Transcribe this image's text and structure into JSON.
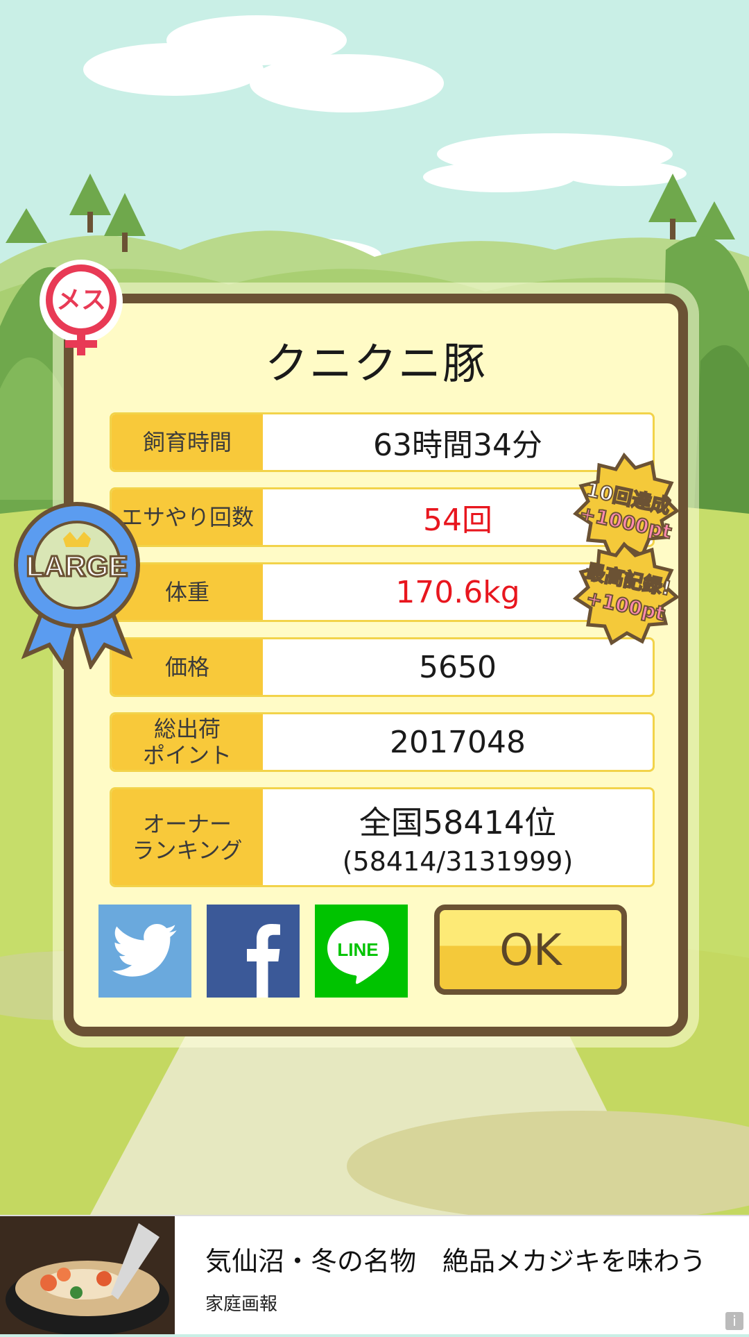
{
  "dialog": {
    "title": "クニクニ豚",
    "gender_badge": "メス",
    "size_ribbon": "LARGE",
    "stats": [
      {
        "label": "飼育時間",
        "value": "63時間34分"
      },
      {
        "label": "エサやり回数",
        "value": "54回"
      },
      {
        "label": "体重",
        "value": "170.6kg"
      },
      {
        "label": "価格",
        "value": "5650"
      },
      {
        "label": "総出荷\nポイント",
        "value": "2017048"
      }
    ],
    "ranking": {
      "label": "オーナー\nランキング",
      "value": "全国58414位",
      "detail": "(58414/3131999)"
    },
    "achievements": [
      {
        "line1": "10回達成",
        "line2": "+1000pt"
      },
      {
        "line1": "最高記録!",
        "line2": "+100pt"
      }
    ],
    "buttons": {
      "twitter": "twitter-icon",
      "facebook": "facebook-icon",
      "line": "LINE",
      "ok": "OK"
    }
  },
  "ad": {
    "title": "気仙沼・冬の名物　絶品メカジキを味わう",
    "source": "家庭画報",
    "info_icon": "i"
  },
  "colors": {
    "frame": "#6b5234",
    "panel": "#fffbc6",
    "label_bg": "#f8c93a",
    "highlight_red": "#e8161e",
    "twitter": "#6aa9dd",
    "facebook": "#3b5998",
    "line": "#00c300"
  }
}
